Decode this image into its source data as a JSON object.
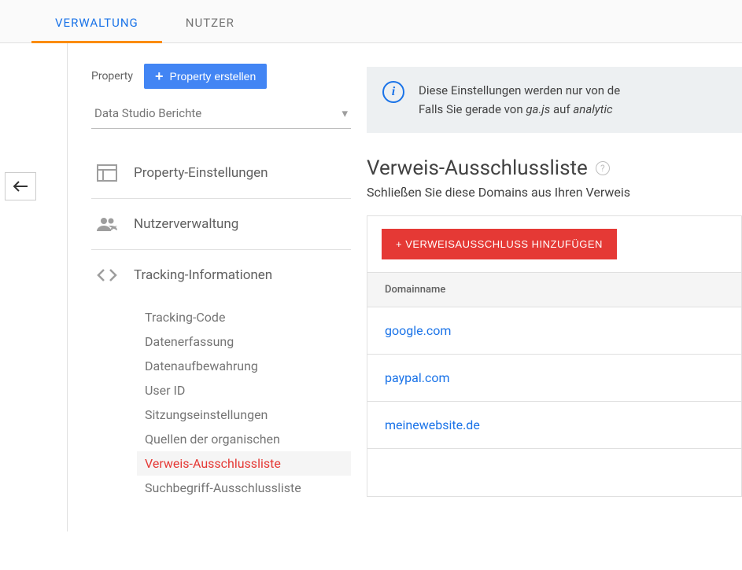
{
  "tabs": {
    "admin": "VERWALTUNG",
    "users": "NUTZER"
  },
  "propertyRow": {
    "label": "Property",
    "createButton": "Property erstellen"
  },
  "propertySelect": {
    "value": "Data Studio Berichte"
  },
  "nav": {
    "settings": "Property-Einstellungen",
    "userMgmt": "Nutzerverwaltung",
    "tracking": "Tracking-Informationen"
  },
  "trackingSub": {
    "code": "Tracking-Code",
    "collection": "Datenerfassung",
    "retention": "Datenaufbewahrung",
    "userId": "User ID",
    "session": "Sitzungseinstellungen",
    "organic": "Quellen der organischen",
    "referralExcl": "Verweis-Ausschlussliste",
    "searchExcl": "Suchbegriff-Ausschlussliste"
  },
  "infoBox": {
    "line1a": "Diese Einstellungen werden nur von de",
    "line2a": "Falls Sie gerade von ",
    "line2b": "ga.js",
    "line2c": " auf ",
    "line2d": "analytic"
  },
  "main": {
    "title": "Verweis-Ausschlussliste",
    "desc": "Schließen Sie diese Domains aus Ihren Verweis",
    "addButton": "+ VERWEISAUSSCHLUSS HINZUFÜGEN",
    "columnHeader": "Domainname",
    "domains": [
      "google.com",
      "paypal.com",
      "meinewebsite.de"
    ]
  }
}
